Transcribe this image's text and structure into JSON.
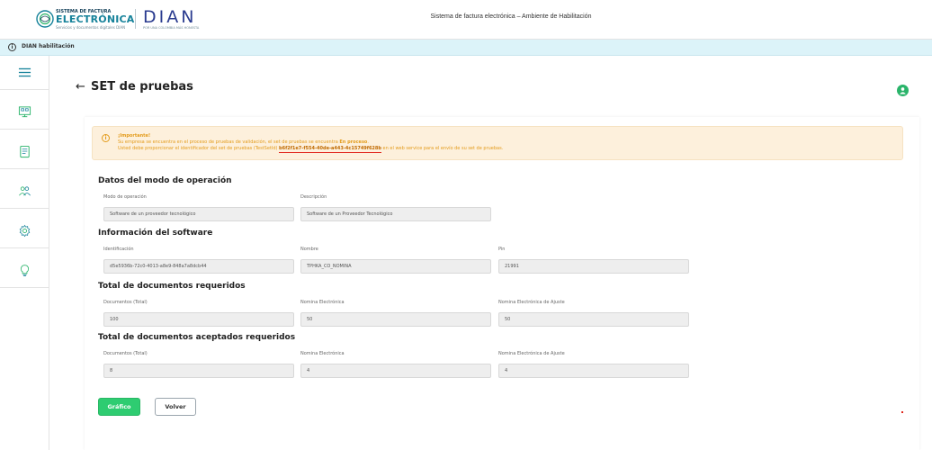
{
  "header": {
    "logo_sf": {
      "line1": "SISTEMA DE FACTURA",
      "line2": "ELECTRÓNICA",
      "line3": "Servicios y documentos digitales DIAN"
    },
    "logo_dian": {
      "word": "DIAN",
      "tag": "POR UNA COLOMBIA MÁS HONESTA"
    },
    "title": "Sistema de factura electrónica – Ambiente de Habilitación"
  },
  "env_bar": {
    "label": "DIAN habilitación"
  },
  "sidebar": {
    "items": [
      {
        "icon": "menu-icon"
      },
      {
        "icon": "monitor-icon"
      },
      {
        "icon": "document-icon"
      },
      {
        "icon": "users-icon"
      },
      {
        "icon": "gear-icon"
      },
      {
        "icon": "lightbulb-icon"
      }
    ]
  },
  "page": {
    "back_arrow": "←",
    "title": "SET de pruebas"
  },
  "alert": {
    "title": "¡Importante!",
    "line1_a": "Su empresa se encuentra en el proceso de pruebas de validación, el set de pruebas se encuentra ",
    "line1_b": "En proceso",
    "line1_c": ".",
    "line2_a": "Usted debe proporcionar el identificador del set de pruebas (TestSetId) ",
    "line2_id": "b6f2f1e7-f554-40de-a443-4c15749f628b",
    "line2_c": " en el web service para el envío de su set de pruebas."
  },
  "operation": {
    "heading": "Datos del modo de operación",
    "mode_label": "Modo de operación",
    "mode_value": "Software de un proveedor tecnológico",
    "desc_label": "Descripción",
    "desc_value": "Software de un Proveedor Tecnológico"
  },
  "software": {
    "heading": "Información del software",
    "id_label": "Identificación",
    "id_value": "d5e5936b-72c0-4013-a8e9-848a7a8dcb44",
    "name_label": "Nombre",
    "name_value": "TPHKA_CO_NOMINA",
    "pin_label": "Pin",
    "pin_value": "21991"
  },
  "required": {
    "heading": "Total de documentos requeridos",
    "total_label": "Documentos (Total)",
    "total_value": "100",
    "nomina_label": "Nomina Electrónica",
    "nomina_value": "50",
    "ajuste_label": "Nomina Electrónica de Ajuste",
    "ajuste_value": "50"
  },
  "accepted": {
    "heading": "Total de documentos aceptados requeridos",
    "total_label": "Documentos (Total)",
    "total_value": "8",
    "nomina_label": "Nomina Electrónica",
    "nomina_value": "4",
    "ajuste_label": "Nomina Electrónica de Ajuste",
    "ajuste_value": "4"
  },
  "buttons": {
    "chart": "Gráfico",
    "back": "Volver"
  },
  "colors": {
    "accent_green": "#2ecc71",
    "env_bar": "#dcf3f9",
    "alert_bg": "#fdf0dc",
    "alert_text": "#e39b1b"
  }
}
